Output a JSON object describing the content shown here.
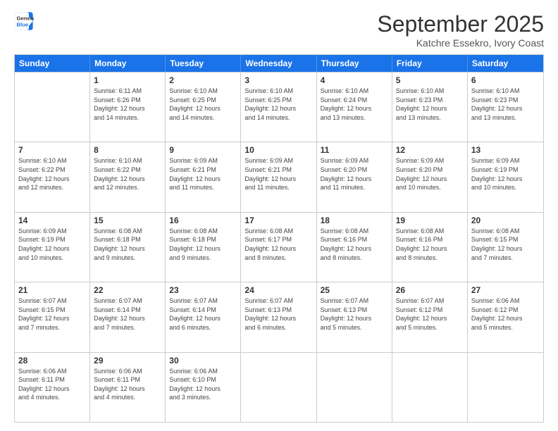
{
  "logo": {
    "line1": "General",
    "line2": "Blue"
  },
  "title": "September 2025",
  "subtitle": "Katchre Essekro, Ivory Coast",
  "header_days": [
    "Sunday",
    "Monday",
    "Tuesday",
    "Wednesday",
    "Thursday",
    "Friday",
    "Saturday"
  ],
  "weeks": [
    [
      {
        "day": "",
        "info": ""
      },
      {
        "day": "1",
        "info": "Sunrise: 6:11 AM\nSunset: 6:26 PM\nDaylight: 12 hours\nand 14 minutes."
      },
      {
        "day": "2",
        "info": "Sunrise: 6:10 AM\nSunset: 6:25 PM\nDaylight: 12 hours\nand 14 minutes."
      },
      {
        "day": "3",
        "info": "Sunrise: 6:10 AM\nSunset: 6:25 PM\nDaylight: 12 hours\nand 14 minutes."
      },
      {
        "day": "4",
        "info": "Sunrise: 6:10 AM\nSunset: 6:24 PM\nDaylight: 12 hours\nand 13 minutes."
      },
      {
        "day": "5",
        "info": "Sunrise: 6:10 AM\nSunset: 6:23 PM\nDaylight: 12 hours\nand 13 minutes."
      },
      {
        "day": "6",
        "info": "Sunrise: 6:10 AM\nSunset: 6:23 PM\nDaylight: 12 hours\nand 13 minutes."
      }
    ],
    [
      {
        "day": "7",
        "info": "Sunrise: 6:10 AM\nSunset: 6:22 PM\nDaylight: 12 hours\nand 12 minutes."
      },
      {
        "day": "8",
        "info": "Sunrise: 6:10 AM\nSunset: 6:22 PM\nDaylight: 12 hours\nand 12 minutes."
      },
      {
        "day": "9",
        "info": "Sunrise: 6:09 AM\nSunset: 6:21 PM\nDaylight: 12 hours\nand 11 minutes."
      },
      {
        "day": "10",
        "info": "Sunrise: 6:09 AM\nSunset: 6:21 PM\nDaylight: 12 hours\nand 11 minutes."
      },
      {
        "day": "11",
        "info": "Sunrise: 6:09 AM\nSunset: 6:20 PM\nDaylight: 12 hours\nand 11 minutes."
      },
      {
        "day": "12",
        "info": "Sunrise: 6:09 AM\nSunset: 6:20 PM\nDaylight: 12 hours\nand 10 minutes."
      },
      {
        "day": "13",
        "info": "Sunrise: 6:09 AM\nSunset: 6:19 PM\nDaylight: 12 hours\nand 10 minutes."
      }
    ],
    [
      {
        "day": "14",
        "info": "Sunrise: 6:09 AM\nSunset: 6:19 PM\nDaylight: 12 hours\nand 10 minutes."
      },
      {
        "day": "15",
        "info": "Sunrise: 6:08 AM\nSunset: 6:18 PM\nDaylight: 12 hours\nand 9 minutes."
      },
      {
        "day": "16",
        "info": "Sunrise: 6:08 AM\nSunset: 6:18 PM\nDaylight: 12 hours\nand 9 minutes."
      },
      {
        "day": "17",
        "info": "Sunrise: 6:08 AM\nSunset: 6:17 PM\nDaylight: 12 hours\nand 8 minutes."
      },
      {
        "day": "18",
        "info": "Sunrise: 6:08 AM\nSunset: 6:16 PM\nDaylight: 12 hours\nand 8 minutes."
      },
      {
        "day": "19",
        "info": "Sunrise: 6:08 AM\nSunset: 6:16 PM\nDaylight: 12 hours\nand 8 minutes."
      },
      {
        "day": "20",
        "info": "Sunrise: 6:08 AM\nSunset: 6:15 PM\nDaylight: 12 hours\nand 7 minutes."
      }
    ],
    [
      {
        "day": "21",
        "info": "Sunrise: 6:07 AM\nSunset: 6:15 PM\nDaylight: 12 hours\nand 7 minutes."
      },
      {
        "day": "22",
        "info": "Sunrise: 6:07 AM\nSunset: 6:14 PM\nDaylight: 12 hours\nand 7 minutes."
      },
      {
        "day": "23",
        "info": "Sunrise: 6:07 AM\nSunset: 6:14 PM\nDaylight: 12 hours\nand 6 minutes."
      },
      {
        "day": "24",
        "info": "Sunrise: 6:07 AM\nSunset: 6:13 PM\nDaylight: 12 hours\nand 6 minutes."
      },
      {
        "day": "25",
        "info": "Sunrise: 6:07 AM\nSunset: 6:13 PM\nDaylight: 12 hours\nand 5 minutes."
      },
      {
        "day": "26",
        "info": "Sunrise: 6:07 AM\nSunset: 6:12 PM\nDaylight: 12 hours\nand 5 minutes."
      },
      {
        "day": "27",
        "info": "Sunrise: 6:06 AM\nSunset: 6:12 PM\nDaylight: 12 hours\nand 5 minutes."
      }
    ],
    [
      {
        "day": "28",
        "info": "Sunrise: 6:06 AM\nSunset: 6:11 PM\nDaylight: 12 hours\nand 4 minutes."
      },
      {
        "day": "29",
        "info": "Sunrise: 6:06 AM\nSunset: 6:11 PM\nDaylight: 12 hours\nand 4 minutes."
      },
      {
        "day": "30",
        "info": "Sunrise: 6:06 AM\nSunset: 6:10 PM\nDaylight: 12 hours\nand 3 minutes."
      },
      {
        "day": "",
        "info": ""
      },
      {
        "day": "",
        "info": ""
      },
      {
        "day": "",
        "info": ""
      },
      {
        "day": "",
        "info": ""
      }
    ]
  ]
}
